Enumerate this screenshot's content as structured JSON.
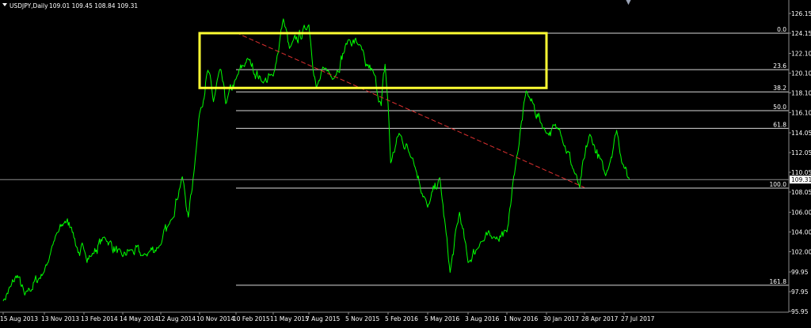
{
  "window": {
    "symbol_title": "USDJPY,Daily",
    "ohlc": "109.01 109.45 108.84 109.31",
    "menu_glyph": "▼"
  },
  "colors": {
    "background": "#000000",
    "price_line": "#00ff00",
    "fib_lines": "#d8d8d8",
    "trendline": "#e03030",
    "highlight_box": "#ffff33",
    "current_price_line": "#8c8c8c"
  },
  "chart_data": {
    "type": "line",
    "title": "USDJPY,Daily",
    "xlabel": "",
    "ylabel": "",
    "y_ticks": [
      126.15,
      124.15,
      122.1,
      120.1,
      118.1,
      116.1,
      114.05,
      112.05,
      110.05,
      108.05,
      106.0,
      104.0,
      102.0,
      99.95,
      97.95,
      95.95
    ],
    "x_ticks": [
      "15 Aug 2013",
      "13 Nov 2013",
      "13 Feb 2014",
      "14 May 2014",
      "12 Aug 2014",
      "10 Nov 2014",
      "10 Feb 2015",
      "11 May 2015",
      "7 Aug 2015",
      "5 Nov 2015",
      "5 Feb 2016",
      "5 May 2016",
      "3 Aug 2016",
      "1 Nov 2016",
      "30 Jan 2017",
      "28 Apr 2017",
      "27 Jul 2017"
    ],
    "ylim": [
      95.95,
      126.6
    ],
    "current_price": 109.31,
    "current_price_label": "109.31",
    "series": [
      {
        "values": [
          [
            "15 Aug 2013",
            97.0
          ],
          [
            "1 Sep 2013",
            98.5
          ],
          [
            "15 Sep 2013",
            99.6
          ],
          [
            "1 Oct 2013",
            97.6
          ],
          [
            "13 Nov 2013",
            100.0
          ],
          [
            "1 Dec 2013",
            102.6
          ],
          [
            "31 Dec 2013",
            105.1
          ],
          [
            "15 Jan 2014",
            104.5
          ],
          [
            "3 Feb 2014",
            101.6
          ],
          [
            "13 Feb 2014",
            102.2
          ],
          [
            "1 Mar 2014",
            101.5
          ],
          [
            "1 Apr 2014",
            103.5
          ],
          [
            "14 May 2014",
            101.5
          ],
          [
            "1 Jun 2014",
            102.2
          ],
          [
            "1 Jul 2014",
            101.6
          ],
          [
            "12 Aug 2014",
            102.7
          ],
          [
            "1 Sep 2014",
            104.8
          ],
          [
            "1 Oct 2014",
            109.6
          ],
          [
            "15 Oct 2014",
            105.5
          ],
          [
            "31 Oct 2014",
            111.5
          ],
          [
            "10 Nov 2014",
            116.0
          ],
          [
            "1 Dec 2014",
            120.4
          ],
          [
            "15 Dec 2014",
            117.2
          ],
          [
            "1 Jan 2015",
            120.5
          ],
          [
            "15 Jan 2015",
            117.0
          ],
          [
            "10 Feb 2015",
            119.5
          ],
          [
            "10 Mar 2015",
            121.6
          ],
          [
            "15 Apr 2015",
            119.2
          ],
          [
            "11 May 2015",
            119.8
          ],
          [
            "5 Jun 2015",
            125.6
          ],
          [
            "20 Jun 2015",
            122.6
          ],
          [
            "7 Aug 2015",
            125.0
          ],
          [
            "24 Aug 2015",
            118.6
          ],
          [
            "15 Sep 2015",
            120.6
          ],
          [
            "1 Oct 2015",
            119.5
          ],
          [
            "5 Nov 2015",
            123.5
          ],
          [
            "1 Dec 2015",
            123.0
          ],
          [
            "15 Dec 2015",
            120.8
          ],
          [
            "1 Jan 2016",
            120.3
          ],
          [
            "20 Jan 2016",
            116.8
          ],
          [
            "29 Jan 2016",
            121.0
          ],
          [
            "5 Feb 2016",
            117.0
          ],
          [
            "11 Feb 2016",
            111.0
          ],
          [
            "1 Mar 2016",
            114.0
          ],
          [
            "1 Apr 2016",
            111.5
          ],
          [
            "5 May 2016",
            106.5
          ],
          [
            "1 Jun 2016",
            109.5
          ],
          [
            "24 Jun 2016",
            99.9
          ],
          [
            "15 Jul 2016",
            106.0
          ],
          [
            "3 Aug 2016",
            100.9
          ],
          [
            "1 Sep 2016",
            103.0
          ],
          [
            "1 Oct 2016",
            103.5
          ],
          [
            "1 Nov 2016",
            104.0
          ],
          [
            "20 Nov 2016",
            110.5
          ],
          [
            "15 Dec 2016",
            118.3
          ],
          [
            "30 Jan 2017",
            114.0
          ],
          [
            "1 Mar 2017",
            114.5
          ],
          [
            "17 Apr 2017",
            108.5
          ],
          [
            "28 Apr 2017",
            111.5
          ],
          [
            "10 May 2017",
            113.9
          ],
          [
            "15 Jun 2017",
            109.7
          ],
          [
            "10 Jul 2017",
            114.3
          ],
          [
            "27 Jul 2017",
            110.5
          ],
          [
            "8 Aug 2017",
            109.3
          ]
        ]
      }
    ],
    "fibonacci": {
      "levels": [
        {
          "label": "0.0",
          "value": 124.15
        },
        {
          "label": "23.6",
          "value": 120.45
        },
        {
          "label": "38.2",
          "value": 118.2
        },
        {
          "label": "50.0",
          "value": 116.3
        },
        {
          "label": "61.8",
          "value": 114.5
        },
        {
          "label": "100.0",
          "value": 108.45
        },
        {
          "label": "161.8",
          "value": 98.6
        }
      ]
    },
    "trendline": {
      "start": [
        "10 Feb 2015",
        124.2
      ],
      "end": [
        "28 Apr 2017",
        108.5
      ],
      "style": "dashed"
    },
    "highlight_box": {
      "x_start": "10 Nov 2014",
      "x_end": "30 Jan 2017",
      "y_top": 124.15,
      "y_bottom": 118.6
    },
    "grid": false,
    "legend": "none"
  }
}
